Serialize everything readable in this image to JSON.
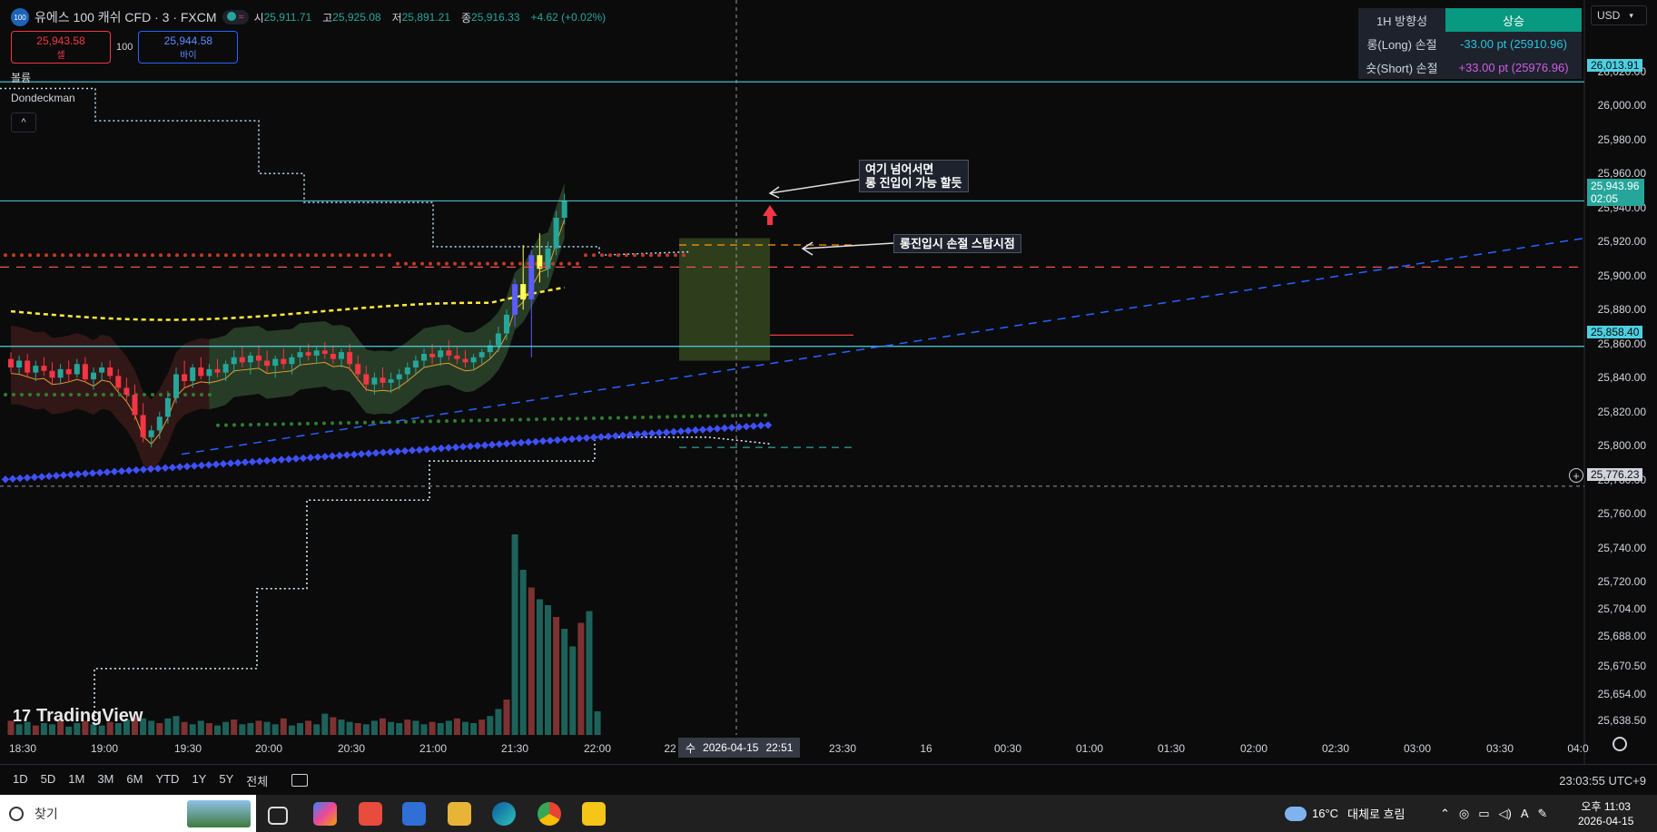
{
  "header": {
    "logo_text": "100",
    "symbol": "유에스 100 캐쉬 CFD · 3 · FXCM",
    "open_label": "시",
    "open": "25,911.71",
    "high_label": "고",
    "high": "25,925.08",
    "low_label": "저",
    "low": "25,891.21",
    "close_label": "종",
    "close": "25,916.33",
    "change": "+4.62 (+0.02%)"
  },
  "trade_panel": {
    "sell_price": "25,943.58",
    "sell_label": "셀",
    "qty": "100",
    "buy_price": "25,944.58",
    "buy_label": "바이"
  },
  "legend": {
    "volume": "볼륨",
    "indicator": "Dondeckman",
    "collapse": "^"
  },
  "direction_table": {
    "header_label": "1H 방향성",
    "header_value": "상승",
    "long_label": "롱(Long) 손절",
    "long_value": "-33.00 pt (25910.96)",
    "short_label": "숏(Short) 손절",
    "short_value": "+33.00 pt (25976.96)"
  },
  "currency": "USD",
  "price_labels": {
    "top_line": "26,013.91",
    "current": "25,943.96",
    "countdown": "02:05",
    "support": "25,858.40",
    "crosshair": "25,776.23"
  },
  "annotations": {
    "upper": "여기 넘어서면\n롱 진입이 가능 할듯",
    "lower": "롱진입시 손절 스탑시점"
  },
  "time_axis": {
    "labels": [
      "18:30",
      "19:00",
      "19:30",
      "20:00",
      "20:30",
      "21:00",
      "21:30",
      "22:00",
      "22",
      "23:30",
      "16",
      "00:30",
      "01:00",
      "01:30",
      "02:00",
      "02:30",
      "03:00",
      "03:30",
      "04:0"
    ],
    "crosshair_day": "수",
    "crosshair_date": "2026-04-15",
    "crosshair_time": "22:51"
  },
  "bottom_bar": {
    "ranges": [
      "1D",
      "5D",
      "1M",
      "3M",
      "6M",
      "YTD",
      "1Y",
      "5Y",
      "전체"
    ],
    "clock": "23:03:55 UTC+9"
  },
  "taskbar": {
    "search_placeholder": "찾기",
    "weather_temp": "16°C",
    "weather_text": "대체로 흐림",
    "time_ampm": "오후 11:03",
    "date": "2026-04-15",
    "ime": "A"
  },
  "brand": "TradingView",
  "colors": {
    "up": "#26a69a",
    "down": "#f23645",
    "accent_blue": "#2962ff",
    "cyan_line": "#4dd0e1"
  },
  "chart_data": {
    "type": "candlestick",
    "ylim": [
      25630,
      26030
    ],
    "y_ticks": [
      26020,
      26000,
      25980,
      25960,
      25940,
      25920,
      25900,
      25880,
      25860,
      25840,
      25820,
      25800,
      25780,
      25760,
      25740,
      25720,
      25704,
      25688,
      25670.5,
      25654,
      25638.5
    ],
    "y_tick_labels": [
      "26,020.00",
      "26,000.00",
      "25,980.00",
      "25,960.00",
      "25,940.00",
      "25,920.00",
      "25,900.00",
      "25,880.00",
      "25,860.00",
      "25,840.00",
      "25,820.00",
      "25,800.00",
      "25,780.00",
      "25,760.00",
      "25,740.00",
      "25,720.00",
      "25,704.00",
      "25,688.00",
      "25,670.50",
      "25,654.00",
      "25,638.50"
    ],
    "candles": {
      "start_time": "18:25",
      "interval_minutes": 3,
      "ohlc": [
        [
          25851,
          25855,
          25843,
          25846
        ],
        [
          25846,
          25853,
          25842,
          25850
        ],
        [
          25850,
          25854,
          25840,
          25843
        ],
        [
          25843,
          25850,
          25838,
          25847
        ],
        [
          25847,
          25852,
          25841,
          25844
        ],
        [
          25844,
          25849,
          25836,
          25840
        ],
        [
          25840,
          25848,
          25836,
          25845
        ],
        [
          25845,
          25850,
          25838,
          25842
        ],
        [
          25842,
          25851,
          25840,
          25848
        ],
        [
          25848,
          25852,
          25837,
          25839
        ],
        [
          25839,
          25846,
          25833,
          25843
        ],
        [
          25843,
          25849,
          25838,
          25846
        ],
        [
          25846,
          25850,
          25839,
          25841
        ],
        [
          25841,
          25845,
          25832,
          25834
        ],
        [
          25834,
          25840,
          25826,
          25830
        ],
        [
          25830,
          25836,
          25815,
          25818
        ],
        [
          25818,
          25825,
          25802,
          25805
        ],
        [
          25805,
          25812,
          25799,
          25809
        ],
        [
          25809,
          25820,
          25804,
          25817
        ],
        [
          25817,
          25832,
          25813,
          25828
        ],
        [
          25828,
          25846,
          25825,
          25842
        ],
        [
          25842,
          25850,
          25834,
          25838
        ],
        [
          25838,
          25848,
          25834,
          25846
        ],
        [
          25846,
          25852,
          25839,
          25841
        ],
        [
          25841,
          25848,
          25836,
          25845
        ],
        [
          25845,
          25851,
          25840,
          25843
        ],
        [
          25843,
          25850,
          25838,
          25848
        ],
        [
          25848,
          25856,
          25843,
          25852
        ],
        [
          25852,
          25858,
          25846,
          25849
        ],
        [
          25849,
          25855,
          25842,
          25853
        ],
        [
          25853,
          25859,
          25846,
          25850
        ],
        [
          25850,
          25856,
          25843,
          25847
        ],
        [
          25847,
          25853,
          25840,
          25851
        ],
        [
          25851,
          25857,
          25845,
          25848
        ],
        [
          25848,
          25854,
          25842,
          25852
        ],
        [
          25852,
          25858,
          25847,
          25855
        ],
        [
          25855,
          25860,
          25850,
          25853
        ],
        [
          25853,
          25858,
          25848,
          25856
        ],
        [
          25856,
          25861,
          25851,
          25854
        ],
        [
          25854,
          25859,
          25848,
          25851
        ],
        [
          25851,
          25857,
          25846,
          25855
        ],
        [
          25855,
          25860,
          25844,
          25848
        ],
        [
          25848,
          25853,
          25838,
          25842
        ],
        [
          25842,
          25847,
          25832,
          25836
        ],
        [
          25836,
          25843,
          25830,
          25840
        ],
        [
          25840,
          25846,
          25834,
          25837
        ],
        [
          25837,
          25843,
          25831,
          25839
        ],
        [
          25839,
          25845,
          25833,
          25842
        ],
        [
          25842,
          25849,
          25838,
          25846
        ],
        [
          25846,
          25853,
          25842,
          25850
        ],
        [
          25850,
          25857,
          25846,
          25854
        ],
        [
          25854,
          25860,
          25848,
          25852
        ],
        [
          25852,
          25858,
          25847,
          25856
        ],
        [
          25856,
          25862,
          25850,
          25853
        ],
        [
          25853,
          25858,
          25848,
          25851
        ],
        [
          25851,
          25856,
          25846,
          25849
        ],
        [
          25849,
          25854,
          25845,
          25852
        ],
        [
          25852,
          25857,
          25848,
          25855
        ],
        [
          25855,
          25862,
          25851,
          25859
        ],
        [
          25859,
          25870,
          25855,
          25866
        ],
        [
          25866,
          25880,
          25862,
          25877
        ],
        [
          25877,
          25898,
          25870,
          25895
        ],
        [
          25895,
          25918,
          25880,
          25886
        ],
        [
          25886,
          25915,
          25852,
          25912
        ],
        [
          25912,
          25925,
          25896,
          25904
        ],
        [
          25904,
          25920,
          25899,
          25916
        ],
        [
          25916,
          25938,
          25912,
          25934
        ],
        [
          25934,
          25948,
          25930,
          25944
        ]
      ]
    },
    "volume": [
      12,
      9,
      11,
      8,
      10,
      9,
      13,
      7,
      10,
      12,
      9,
      8,
      11,
      10,
      13,
      15,
      14,
      12,
      10,
      14,
      16,
      11,
      9,
      12,
      10,
      8,
      11,
      13,
      9,
      10,
      12,
      11,
      9,
      14,
      8,
      10,
      12,
      9,
      18,
      15,
      13,
      11,
      10,
      9,
      12,
      14,
      11,
      10,
      13,
      12,
      9,
      11,
      10,
      12,
      14,
      11,
      10,
      13,
      16,
      22,
      30,
      170,
      140,
      125,
      115,
      110,
      100,
      90,
      75,
      95,
      105,
      20
    ],
    "levels": {
      "resistance_cyan": 26013.91,
      "current_price": 25943.96,
      "support_cyan": 25858.4,
      "red_dashed": 25905,
      "orange_dashed": 25918,
      "teal_dashed": 25799,
      "red_short": 25865,
      "crosshair": 25776.23
    }
  }
}
